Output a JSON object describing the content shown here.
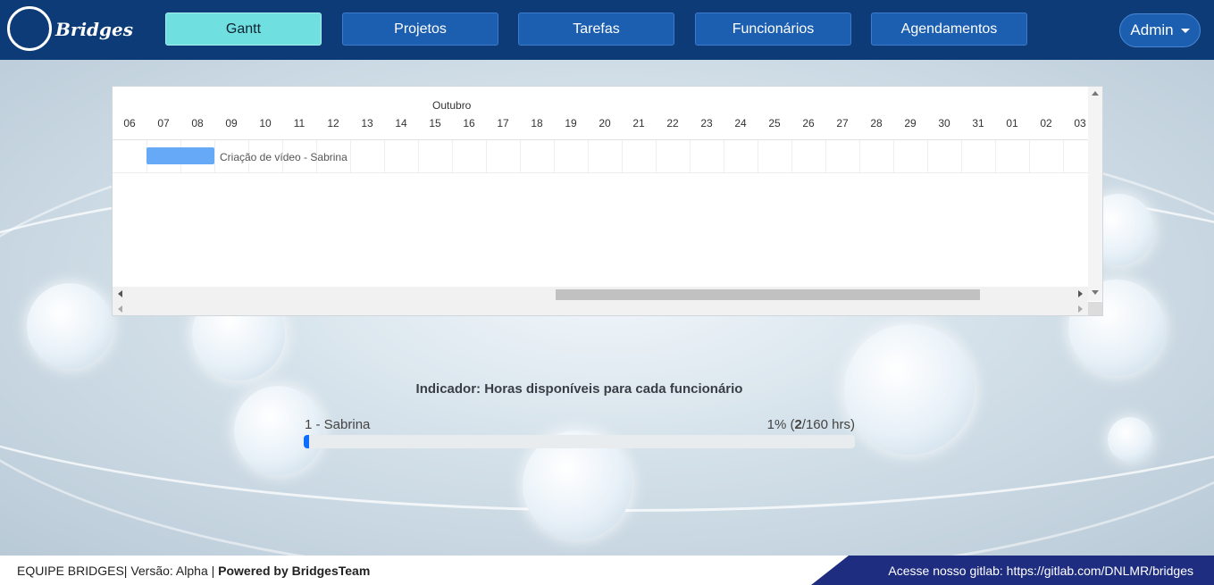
{
  "brand": {
    "name": "Bridges"
  },
  "nav": {
    "items": [
      {
        "label": "Gantt",
        "active": true
      },
      {
        "label": "Projetos",
        "active": false
      },
      {
        "label": "Tarefas",
        "active": false
      },
      {
        "label": "Funcionários",
        "active": false
      },
      {
        "label": "Agendamentos",
        "active": false
      }
    ],
    "user_menu": "Admin"
  },
  "gantt": {
    "month": "Outubro",
    "days": [
      "06",
      "07",
      "08",
      "09",
      "10",
      "11",
      "12",
      "13",
      "14",
      "15",
      "16",
      "17",
      "18",
      "19",
      "20",
      "21",
      "22",
      "23",
      "24",
      "25",
      "26",
      "27",
      "28",
      "29",
      "30",
      "31",
      "01",
      "02",
      "03"
    ],
    "tasks": [
      {
        "label": "Criação de vídeo - Sabrina",
        "start_day": "07",
        "end_day": "08"
      }
    ]
  },
  "indicator": {
    "title": "Indicador: Horas disponíveis para cada funcionário",
    "employees": [
      {
        "name": "1 - Sabrina",
        "percent_text": "1% (",
        "used": "2",
        "total_text": "/160 hrs)",
        "fill_fraction": 0.01
      }
    ]
  },
  "footer": {
    "team": "EQUIPE BRIDGES| Versão: Alpha | ",
    "powered": "Powered by BridgesTeam",
    "gitlab": "Acesse nosso gitlab: https://gitlab.com/DNLMR/bridges"
  },
  "colors": {
    "header_bg": "#0d3b77",
    "nav_button": "#1c5fb0",
    "nav_active": "#6fdfdf",
    "task_bar": "#65a9f7",
    "progress_fill": "#0d6efd",
    "footer_accent": "#1f2d80"
  }
}
